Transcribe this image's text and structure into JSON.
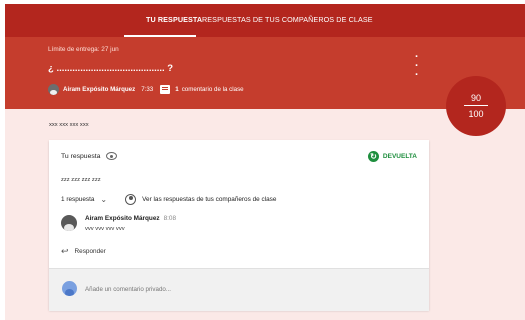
{
  "tabs": {
    "mine": "TU RESPUESTA",
    "peers": "RESPUESTAS DE TUS COMPAÑEROS DE CLASE"
  },
  "header": {
    "due": "Límite de entrega: 27 jun",
    "question": "¿ ......................................... ?",
    "menu_icon": "more-vert-icon",
    "author": "Airam Expósito Márquez",
    "time": "7:33",
    "comment_icon": "comment-icon",
    "comment_count": "1",
    "comment_label": "comentario de la clase"
  },
  "grade": {
    "score": "90",
    "total": "100"
  },
  "instructions": "xxx xxx xxx xxx",
  "answer": {
    "title": "Tu respuesta",
    "visibility_icon": "eye-icon",
    "status": "DEVUELTA",
    "status_icon": "returned-check-icon",
    "text": "zzz zzz zzz zzz",
    "reply_count": "1 respuesta",
    "peers_link": "Ver las respuestas de tus compañeros de clase"
  },
  "comment": {
    "author": "Airam Expósito Márquez",
    "time": "8:08",
    "text": "vvv vvv vvv vvv"
  },
  "reply_button": "Responder",
  "private_comment": {
    "placeholder": "Añade un comentario privado..."
  },
  "colors": {
    "primary": "#b3261e",
    "header": "#c53d2d",
    "background": "#fbe9e7",
    "returned": "#1e8e3e"
  }
}
